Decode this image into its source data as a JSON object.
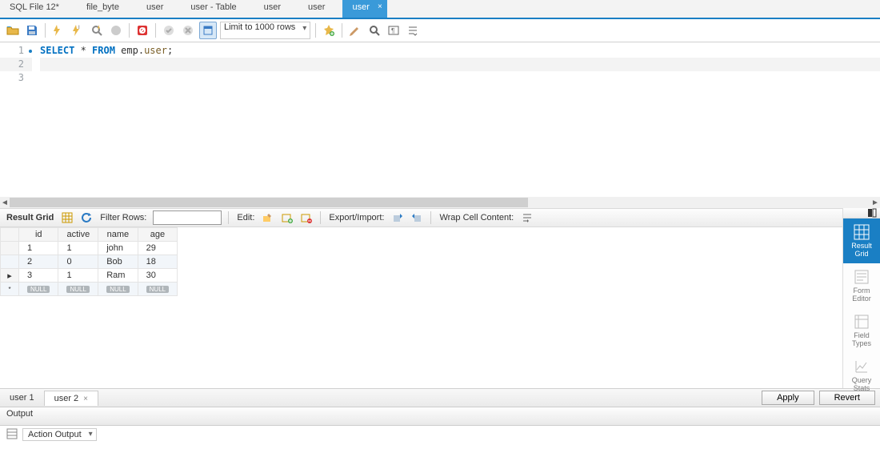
{
  "tabs": [
    {
      "label": "SQL File 12*",
      "close": false
    },
    {
      "label": "file_byte",
      "close": false
    },
    {
      "label": "user",
      "close": false
    },
    {
      "label": "user - Table",
      "close": false
    },
    {
      "label": "user",
      "close": false
    },
    {
      "label": "user",
      "close": false
    },
    {
      "label": "user",
      "close": true,
      "active": true
    }
  ],
  "toolbar": {
    "limit_label": "Limit to 1000 rows"
  },
  "editor": {
    "lines": [
      "1",
      "2",
      "3"
    ],
    "kw_select": "SELECT",
    "star": " * ",
    "kw_from": "FROM",
    "schema": " emp.",
    "table": "user",
    "semi": ";"
  },
  "grid_toolbar": {
    "result_grid": "Result Grid",
    "filter_rows": "Filter Rows:",
    "filter_value": "",
    "edit": "Edit:",
    "export_import": "Export/Import:",
    "wrap": "Wrap Cell Content:"
  },
  "columns": [
    "id",
    "active",
    "name",
    "age"
  ],
  "rows": [
    {
      "id": "1",
      "active": "1",
      "name": "john",
      "age": "29"
    },
    {
      "id": "2",
      "active": "0",
      "name": "Bob",
      "age": "18"
    },
    {
      "id": "3",
      "active": "1",
      "name": "Ram",
      "age": "30",
      "current": true
    }
  ],
  "null_label": "NULL",
  "side_panels": [
    {
      "key": "result-grid",
      "l1": "Result",
      "l2": "Grid",
      "active": true
    },
    {
      "key": "form-editor",
      "l1": "Form",
      "l2": "Editor"
    },
    {
      "key": "field-types",
      "l1": "Field",
      "l2": "Types"
    },
    {
      "key": "query-stats",
      "l1": "Query",
      "l2": "Stats"
    }
  ],
  "result_tabs": [
    {
      "label": "user 1"
    },
    {
      "label": "user 2",
      "active": true,
      "close": true
    }
  ],
  "buttons": {
    "apply": "Apply",
    "revert": "Revert"
  },
  "output": {
    "header": "Output",
    "select": "Action Output"
  }
}
